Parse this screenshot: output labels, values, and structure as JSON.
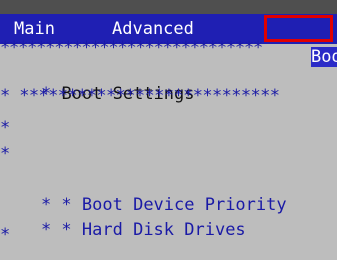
{
  "menu": {
    "items": [
      {
        "label": "Main"
      },
      {
        "label": "Advanced"
      },
      {
        "label": "Boot"
      }
    ]
  },
  "content": {
    "separator": "*****************************",
    "title_prefix": "* ",
    "title": "Boot Settings",
    "title_separator": "* ***************************",
    "star": "*",
    "item1_prefix": "* * ",
    "item1": "Boot Device Priority",
    "item2_prefix": "* * ",
    "item2": "Hard Disk Drives"
  },
  "colors": {
    "background": "#bdbdbd",
    "menubar": "#1f1fb3",
    "selected_outline": "#e00000",
    "text_blue": "#1a1aa6"
  }
}
